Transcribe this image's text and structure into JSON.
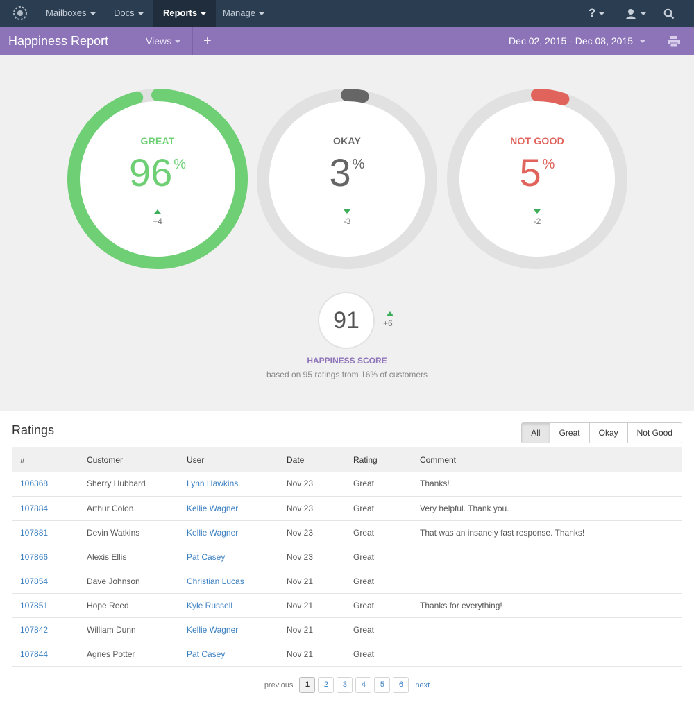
{
  "nav": {
    "items": [
      {
        "label": "Mailboxes"
      },
      {
        "label": "Docs"
      },
      {
        "label": "Reports"
      },
      {
        "label": "Manage"
      }
    ],
    "help_icon": "help-icon",
    "user_icon": "user-icon",
    "search_icon": "search-icon"
  },
  "subheader": {
    "title": "Happiness Report",
    "views_label": "Views",
    "add_label": "+",
    "date_range": "Dec 02, 2015 - Dec 08, 2015",
    "print_icon": "print-icon"
  },
  "gauges": [
    {
      "label": "GREAT",
      "value": "96",
      "percent": 96,
      "change": "+4",
      "direction": "up",
      "color": "#6fcf75"
    },
    {
      "label": "OKAY",
      "value": "3",
      "percent": 3,
      "change": "-3",
      "direction": "down",
      "color": "#666666"
    },
    {
      "label": "NOT GOOD",
      "value": "5",
      "percent": 5,
      "change": "-2",
      "direction": "down",
      "color": "#e0635c"
    }
  ],
  "pct_symbol": "%",
  "score": {
    "value": "91",
    "change": "+6",
    "title": "HAPPINESS SCORE",
    "subtitle": "based on 95 ratings from 16% of customers"
  },
  "ratings": {
    "title": "Ratings",
    "filters": [
      "All",
      "Great",
      "Okay",
      "Not Good"
    ],
    "active_filter": "All",
    "columns": [
      "#",
      "Customer",
      "User",
      "Date",
      "Rating",
      "Comment"
    ],
    "rows": [
      {
        "id": "106368",
        "customer": "Sherry Hubbard",
        "user": "Lynn Hawkins",
        "date": "Nov 23",
        "rating": "Great",
        "comment": "Thanks!"
      },
      {
        "id": "107884",
        "customer": "Arthur Colon",
        "user": "Kellie Wagner",
        "date": "Nov 23",
        "rating": "Great",
        "comment": "Very helpful. Thank you."
      },
      {
        "id": "107881",
        "customer": "Devin Watkins",
        "user": "Kellie Wagner",
        "date": "Nov 23",
        "rating": "Great",
        "comment": "That was an insanely fast response. Thanks!"
      },
      {
        "id": "107866",
        "customer": "Alexis Ellis",
        "user": "Pat Casey",
        "date": "Nov 23",
        "rating": "Great",
        "comment": ""
      },
      {
        "id": "107854",
        "customer": "Dave Johnson",
        "user": "Christian Lucas",
        "date": "Nov 21",
        "rating": "Great",
        "comment": ""
      },
      {
        "id": "107851",
        "customer": "Hope Reed",
        "user": "Kyle Russell",
        "date": "Nov 21",
        "rating": "Great",
        "comment": "Thanks for everything!"
      },
      {
        "id": "107842",
        "customer": "William Dunn",
        "user": "Kellie Wagner",
        "date": "Nov 21",
        "rating": "Great",
        "comment": ""
      },
      {
        "id": "107844",
        "customer": "Agnes Potter",
        "user": "Pat Casey",
        "date": "Nov 21",
        "rating": "Great",
        "comment": ""
      }
    ]
  },
  "pagination": {
    "previous": "previous",
    "next": "next",
    "pages": [
      "1",
      "2",
      "3",
      "4",
      "5",
      "6"
    ],
    "current": "1"
  }
}
